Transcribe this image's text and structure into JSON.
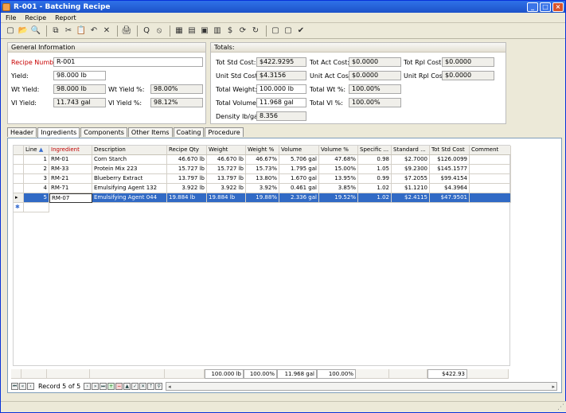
{
  "window": {
    "title": "R-001 - Batching Recipe",
    "controls": [
      "_",
      "□",
      "×"
    ]
  },
  "menu": [
    "File",
    "Recipe",
    "Report"
  ],
  "toolbar": [
    "new-icon",
    "open-icon",
    "find-icon",
    "copy-icon",
    "cut-icon",
    "paste-icon",
    "undo-icon",
    "delete-icon",
    "print-preview-icon",
    "query-icon",
    "stop-icon",
    "calc-icon",
    "batch-icon",
    "folder-icon",
    "table-icon",
    "dollar-icon",
    "refresh-dollar-icon",
    "recalc-icon",
    "lock-icon",
    "unlock-icon",
    "check-icon"
  ],
  "general": {
    "header": "General Information",
    "recipe_number_label": "Recipe Number:",
    "recipe_number": "R-001",
    "yield_label": "Yield:",
    "yield": "98.000 lb",
    "wt_yield_label": "Wt Yield:",
    "wt_yield": "98.000 lb",
    "wt_yield_pct_label": "Wt Yield %:",
    "wt_yield_pct": "98.00%",
    "vl_yield_label": "Vl Yield:",
    "vl_yield": "11.743 gal",
    "vl_yield_pct_label": "Vl Yield %:",
    "vl_yield_pct": "98.12%"
  },
  "totals": {
    "header": "Totals:",
    "tot_std_cost_label": "Tot Std Cost:",
    "tot_std_cost": "$422.9295",
    "tot_act_cost_label": "Tot Act Cost:",
    "tot_act_cost": "$0.0000",
    "tot_rpl_cost_label": "Tot Rpl Cost:",
    "tot_rpl_cost": "$0.0000",
    "unit_std_cost_label": "Unit Std Cost:",
    "unit_std_cost": "$4.3156",
    "unit_act_cost_label": "Unit Act Cost:",
    "unit_act_cost": "$0.0000",
    "unit_rpl_cost_label": "Unit Rpl Cost:",
    "unit_rpl_cost": "$0.0000",
    "total_weight_label": "Total Weight:",
    "total_weight": "100.000 lb",
    "total_wt_pct_label": "Total Wt %:",
    "total_wt_pct": "100.00%",
    "total_volume_label": "Total Volume:",
    "total_volume": "11.968 gal",
    "total_vl_pct_label": "Total Vl %:",
    "total_vl_pct": "100.00%",
    "density_label": "Density lb/gal:",
    "density": "8.356"
  },
  "tabs": [
    "Header",
    "Ingredients",
    "Components",
    "Other Items",
    "Coating",
    "Procedure"
  ],
  "grid": {
    "columns": [
      "Line",
      "Ingredient",
      "Description",
      "Recipe Qty",
      "Weight",
      "Weight %",
      "Volume",
      "Volume %",
      "Specific ...",
      "Standard ...",
      "Tot Std Cost",
      "Comment"
    ],
    "rows": [
      [
        "1",
        "RM-01",
        "Corn Starch",
        "46.670 lb",
        "46.670 lb",
        "46.67%",
        "5.706 gal",
        "47.68%",
        "0.98",
        "$2.7000",
        "$126.0099",
        ""
      ],
      [
        "2",
        "RM-33",
        "Protein Mix 223",
        "15.727 lb",
        "15.727 lb",
        "15.73%",
        "1.795 gal",
        "15.00%",
        "1.05",
        "$9.2300",
        "$145.1577",
        ""
      ],
      [
        "3",
        "RM-21",
        "Blueberry Extract",
        "13.797 lb",
        "13.797 lb",
        "13.80%",
        "1.670 gal",
        "13.95%",
        "0.99",
        "$7.2055",
        "$99.4154",
        ""
      ],
      [
        "4",
        "RM-71",
        "Emulsifying Agent 132",
        "3.922 lb",
        "3.922 lb",
        "3.92%",
        "0.461 gal",
        "3.85%",
        "1.02",
        "$1.1210",
        "$4.3964",
        ""
      ],
      [
        "5",
        "RM-07",
        "Emulsifying Agent 044",
        "19.884 lb",
        "19.884 lb",
        "19.88%",
        "2.336 gal",
        "19.52%",
        "1.02",
        "$2.4115",
        "$47.9501",
        ""
      ]
    ],
    "footer": {
      "weight": "100.000 lb",
      "weight_pct": "100.00%",
      "volume": "11.968 gal",
      "volume_pct": "100.00%",
      "tot_std_cost": "$422.93"
    }
  },
  "navigator": {
    "record_text": "Record 5 of 5"
  }
}
